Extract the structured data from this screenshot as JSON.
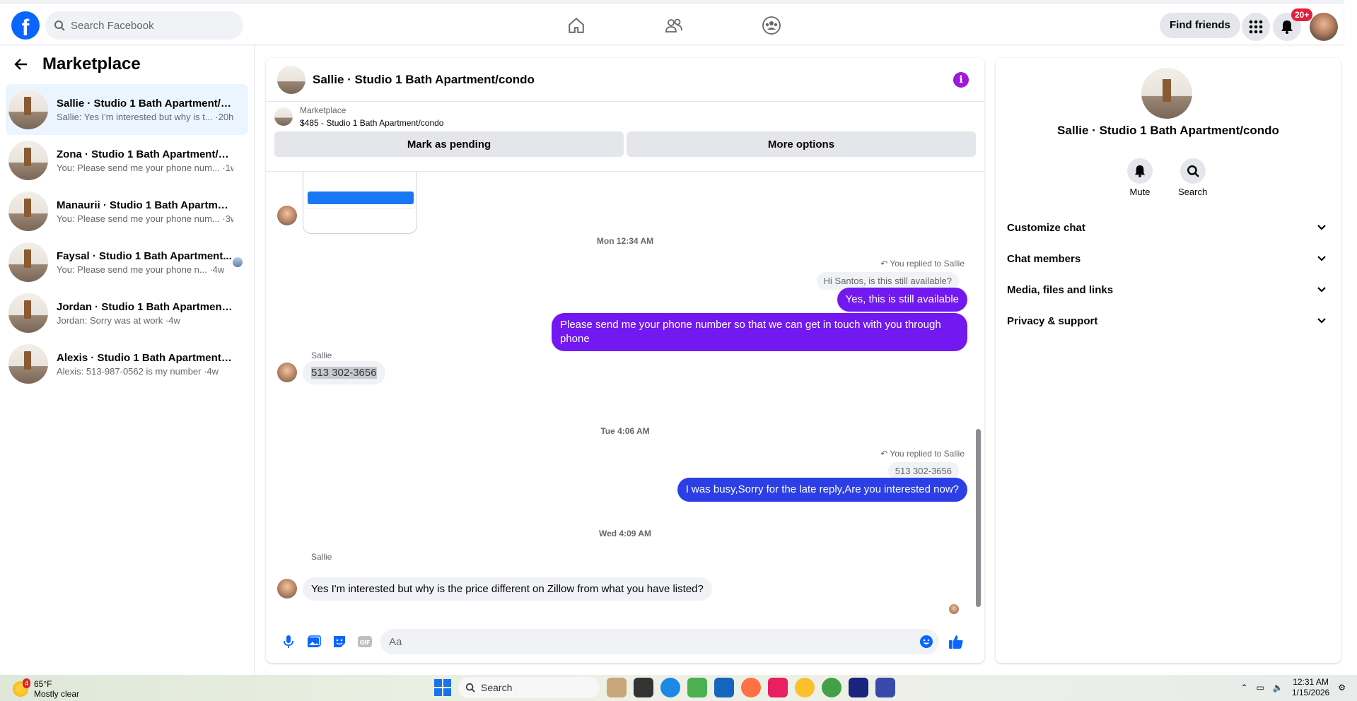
{
  "header": {
    "search_placeholder": "Search Facebook",
    "find_friends": "Find friends",
    "notifications_badge": "20+",
    "logo": "f"
  },
  "sidebar": {
    "title": "Marketplace",
    "conversations": [
      {
        "title": "Sallie · Studio 1 Bath Apartment/c...",
        "subtitle": "Sallie: Yes I'm interested but why is t... ·20h",
        "active": true
      },
      {
        "title": "Zona · Studio 1 Bath Apartment/co...",
        "subtitle": "You: Please send me your phone num... ·1w"
      },
      {
        "title": "Manaurii · Studio 1 Bath Apartmen...",
        "subtitle": "You: Please send me your phone num... ·3w"
      },
      {
        "title": "Faysal · Studio 1 Bath Apartment...",
        "subtitle": "You: Please send me your phone n... ·4w"
      },
      {
        "title": "Jordan · Studio 1 Bath Apartment/...",
        "subtitle": "Jordan: Sorry was at work ·4w"
      },
      {
        "title": "Alexis · Studio 1 Bath Apartment/c...",
        "subtitle": "Alexis: 513-987-0562 is my number ·4w"
      }
    ]
  },
  "chat": {
    "title": "Sallie · Studio 1 Bath Apartment/condo",
    "marketplace_label": "Marketplace",
    "listing": "$485 - Studio 1 Bath Apartment/condo",
    "mark_pending": "Mark as pending",
    "more_options": "More options",
    "messages": {
      "ts1": "Mon 12:34 AM",
      "replied1": "You replied to Sallie",
      "quote1": "Hi Santos, is this still available?",
      "out1": "Yes, this is still available",
      "out2": "Please send me your phone  number so that we can get in touch with you through phone",
      "sender1": "Sallie",
      "in1": "513 302-3656",
      "ts2": "Tue 4:06 AM",
      "replied2": "You replied to Sallie",
      "quote2": "513 302-3656",
      "out3": "I was busy,Sorry for the late reply,Are you interested now?",
      "ts3": "Wed 4:09 AM",
      "sender2": "Sallie",
      "in2": "Yes I'm interested but why is the price different on Zillow from what you have listed?"
    },
    "composer_placeholder": "Aa"
  },
  "details": {
    "name": "Sallie · Studio 1 Bath Apartment/condo",
    "mute": "Mute",
    "search": "Search",
    "menu": [
      "Customize chat",
      "Chat members",
      "Media, files and links",
      "Privacy & support"
    ]
  },
  "taskbar": {
    "temp": "65°F",
    "weather": "Mostly clear",
    "weather_badge": "4",
    "search": "Search",
    "time": "12:31 AM",
    "date": "1/15/2026"
  }
}
